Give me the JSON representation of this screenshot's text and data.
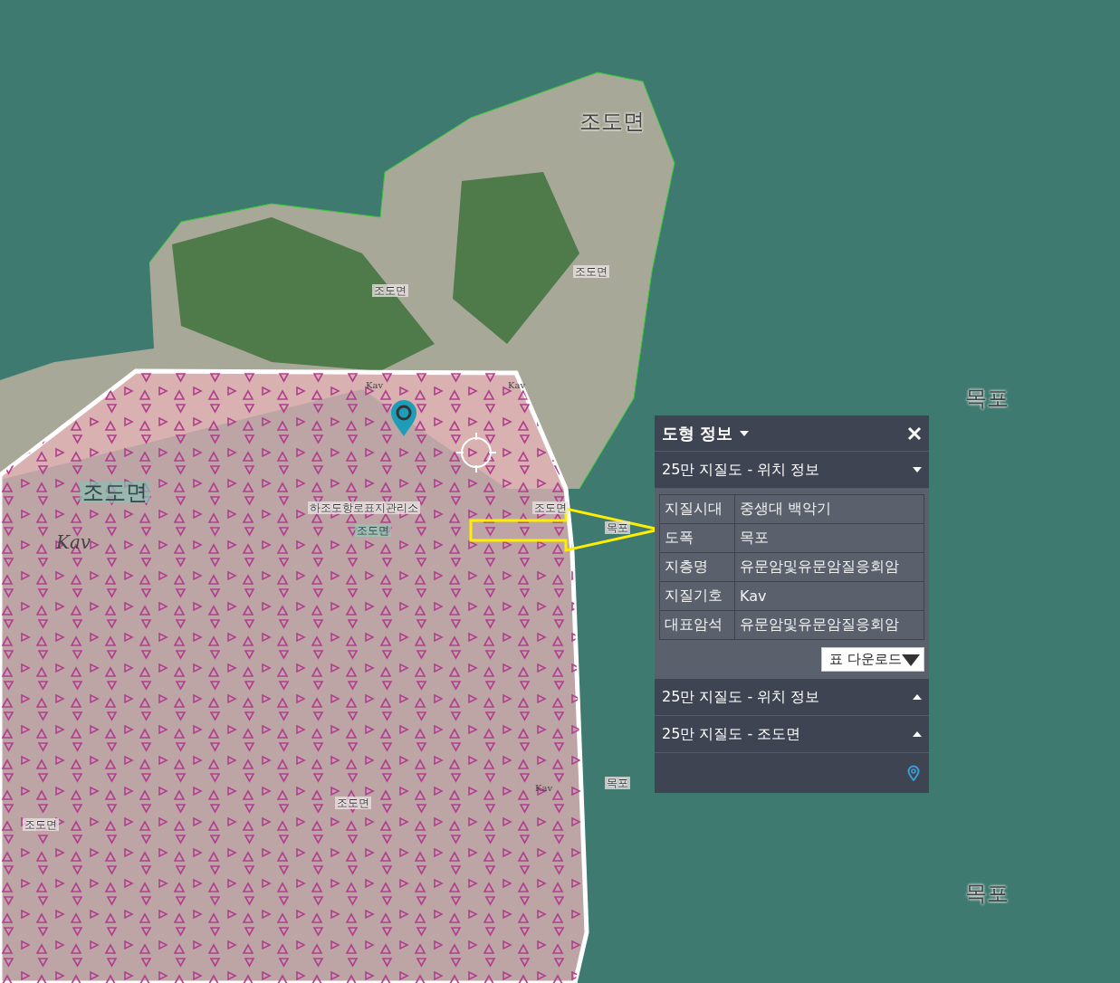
{
  "map": {
    "labels": [
      {
        "text": "조도면",
        "kind": "large"
      },
      {
        "text": "조도면",
        "kind": "small"
      },
      {
        "text": "조도면",
        "kind": "small"
      },
      {
        "text": "Kav",
        "kind": "tiny"
      },
      {
        "text": "Kav",
        "kind": "tiny"
      },
      {
        "text": "조도면",
        "kind": "badge"
      },
      {
        "text": "Kav",
        "kind": "symbol"
      },
      {
        "text": "하조도항로표지관리소",
        "kind": "small"
      },
      {
        "text": "조도면",
        "kind": "badge-small"
      },
      {
        "text": "조도면",
        "kind": "small"
      },
      {
        "text": "목포",
        "kind": "small"
      },
      {
        "text": "목포",
        "kind": "large"
      },
      {
        "text": "목포",
        "kind": "small"
      },
      {
        "text": "Kav",
        "kind": "tiny"
      },
      {
        "text": "조도면",
        "kind": "small"
      },
      {
        "text": "조도면",
        "kind": "small"
      },
      {
        "text": "목포",
        "kind": "large"
      }
    ]
  },
  "panel": {
    "title": "도형 정보",
    "sections": [
      {
        "title": "25만 지질도 - 위치 정보",
        "expanded": true,
        "rows": [
          {
            "key": "지질시대",
            "value": "중생대  백악기"
          },
          {
            "key": "도폭",
            "value": "목포"
          },
          {
            "key": "지층명",
            "value": "유문암및유문암질응회암"
          },
          {
            "key": "지질기호",
            "value": "Kav"
          },
          {
            "key": "대표암석",
            "value": "유문암및유문암질응회암"
          }
        ],
        "download": "표 다운로드"
      },
      {
        "title": "25만 지질도 - 위치 정보",
        "expanded": false
      },
      {
        "title": "25만 지질도 - 조도면",
        "expanded": false
      }
    ]
  }
}
